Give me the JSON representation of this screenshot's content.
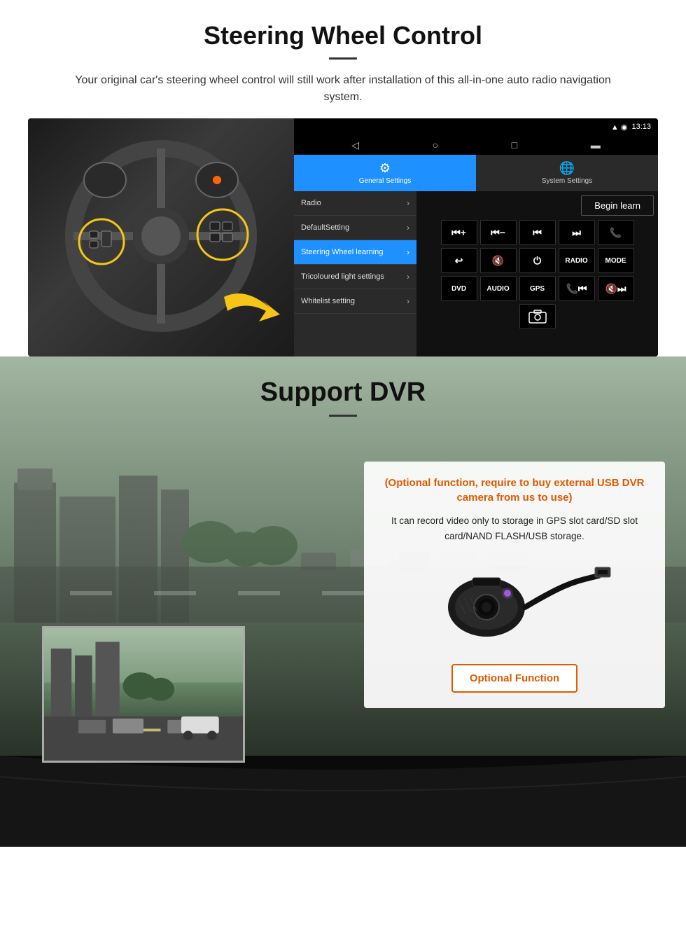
{
  "page": {
    "section1": {
      "title": "Steering Wheel Control",
      "description": "Your original car's steering wheel control will still work after installation of this all-in-one auto radio navigation system.",
      "android_ui": {
        "status_time": "13:13",
        "tab_general": "General Settings",
        "tab_system": "System Settings",
        "menu_items": [
          {
            "label": "Radio",
            "active": false
          },
          {
            "label": "DefaultSetting",
            "active": false
          },
          {
            "label": "Steering Wheel learning",
            "active": true
          },
          {
            "label": "Tricoloured light settings",
            "active": false
          },
          {
            "label": "Whitelist setting",
            "active": false
          }
        ],
        "begin_learn_label": "Begin learn",
        "control_buttons": [
          [
            "vol+",
            "vol-",
            "prev",
            "next",
            "phone"
          ],
          [
            "back",
            "mute",
            "power",
            "RADIO",
            "MODE"
          ],
          [
            "DVD",
            "AUDIO",
            "GPS",
            "tel+prev",
            "mute+next"
          ]
        ]
      }
    },
    "section2": {
      "title": "Support DVR",
      "optional_text": "(Optional function, require to buy external USB DVR camera from us to use)",
      "description": "It can record video only to storage in GPS slot card/SD slot card/NAND FLASH/USB storage.",
      "optional_button_label": "Optional Function"
    }
  }
}
